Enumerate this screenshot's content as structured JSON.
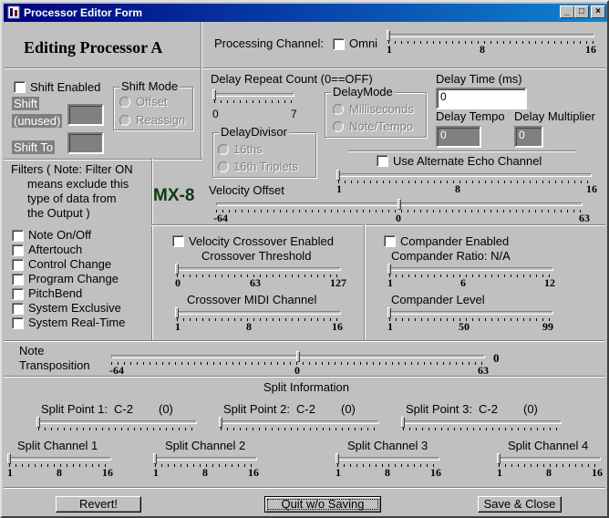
{
  "window": {
    "title": "Processor Editor Form",
    "btn_min": "_",
    "btn_max": "□",
    "btn_close": "×"
  },
  "header": {
    "editing": "Editing Processor  A",
    "logo": "MX-8"
  },
  "processing": {
    "label": "Processing Channel:",
    "omni": "Omni",
    "ticks": [
      "1",
      "8",
      "16"
    ]
  },
  "shift": {
    "enabled": "Shift Enabled",
    "shift": "Shift",
    "unused": "(unused)",
    "shift_to": "Shift To",
    "mode_legend": "Shift Mode",
    "offset": "Offset",
    "reassign": "Reassign"
  },
  "delay": {
    "repeat_label": "Delay Repeat Count (0==OFF)",
    "repeat_ticks": [
      "0",
      "7"
    ],
    "mode_legend": "DelayMode",
    "milliseconds": "Milliseconds",
    "note_tempo": "Note/Tempo",
    "time_label": "Delay Time (ms)",
    "time_value": "0",
    "tempo_label": "Delay Tempo",
    "tempo_value": "0",
    "multiplier_label": "Delay Multiplier",
    "multiplier_value": "0",
    "divisor_legend": "DelayDivisor",
    "sixteenths": "16ths",
    "triplets": "16th Triplets"
  },
  "filters": {
    "note": "Filters ( Note: Filter ON means exclude this type of data from the Output )",
    "note_lines": [
      "Filters ( Note: Filter ON",
      "means exclude this",
      "type of data from",
      "the Output )"
    ],
    "items": [
      "Note On/Off",
      "Aftertouch",
      "Control Change",
      "Program Change",
      "PitchBend",
      "System Exclusive",
      "System Real-Time"
    ]
  },
  "echo": {
    "label": "Use Alternate Echo Channel",
    "ticks": [
      "1",
      "8",
      "16"
    ]
  },
  "velocity": {
    "label": "Velocity Offset",
    "ticks": [
      "-64",
      "0",
      "63"
    ]
  },
  "crossover": {
    "enabled": "Velocity Crossover Enabled",
    "threshold": "Crossover Threshold",
    "threshold_ticks": [
      "0",
      "63",
      "127"
    ],
    "channel": "Crossover MIDI Channel",
    "channel_ticks": [
      "1",
      "8",
      "16"
    ]
  },
  "compander": {
    "enabled": "Compander Enabled",
    "ratio": "Compander Ratio: N/A",
    "ratio_ticks": [
      "1",
      "6",
      "12"
    ],
    "level": "Compander Level",
    "level_ticks": [
      "1",
      "50",
      "99"
    ]
  },
  "transposition": {
    "label_line1": "Note",
    "label_line2": "Transposition",
    "ticks": [
      "-64",
      "0",
      "63"
    ],
    "value": "0"
  },
  "split": {
    "title": "Split Information",
    "points": [
      {
        "label": "Split Point 1:",
        "note": "C-2",
        "value": "(0)"
      },
      {
        "label": "Split Point 2:",
        "note": "C-2",
        "value": "(0)"
      },
      {
        "label": "Split Point 3:",
        "note": "C-2",
        "value": "(0)"
      }
    ],
    "channels": [
      "Split Channel 1",
      "Split Channel 2",
      "Split Channel 3",
      "Split Channel 4"
    ],
    "channel_ticks": [
      "1",
      "8",
      "16"
    ]
  },
  "buttons": {
    "revert": "Revert!",
    "quit": "Quit w/o Saving",
    "save": "Save & Close"
  },
  "sliders": {
    "processing": 0,
    "repeat": 0,
    "echo": 0,
    "velocity": 0.5,
    "threshold": 0,
    "xchannel": 0,
    "ratio": 0,
    "level": 0,
    "transposition": 0.5,
    "sp1": 0,
    "sp2": 0,
    "sp3": 0,
    "sc1": 0,
    "sc2": 0,
    "sc3": 0,
    "sc4": 0
  }
}
